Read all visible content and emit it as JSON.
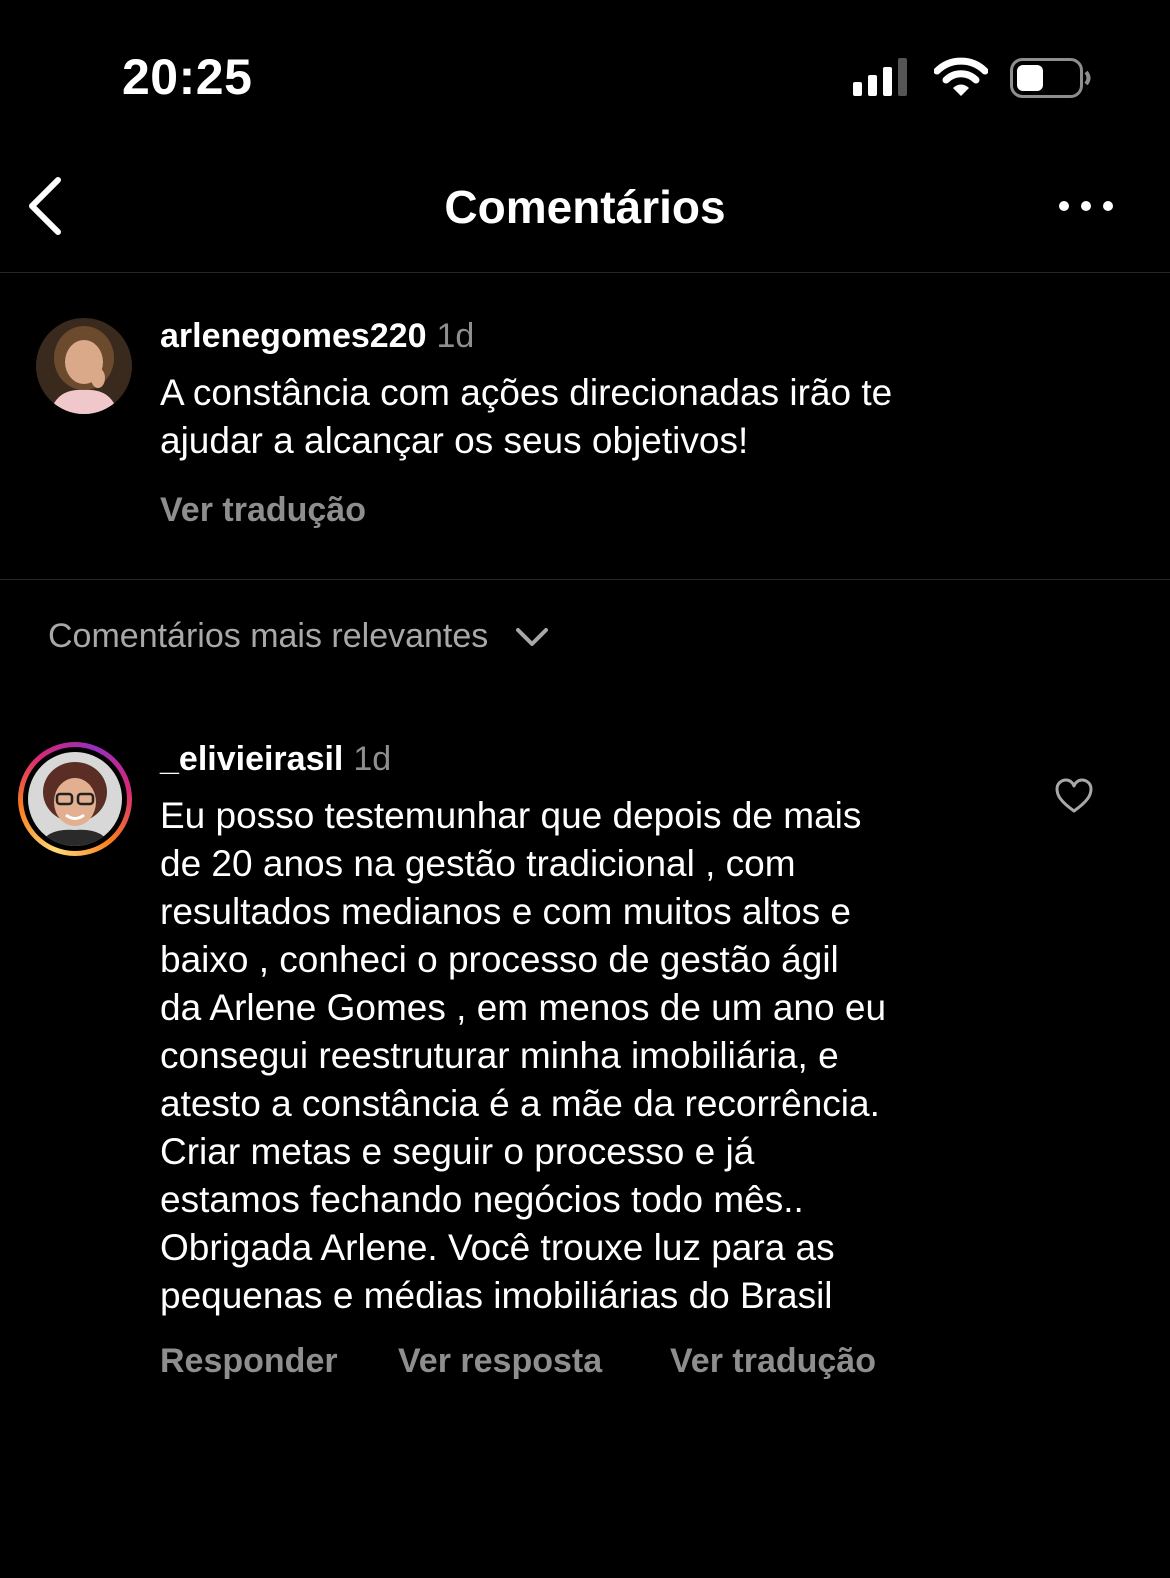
{
  "status_bar": {
    "time": "20:25",
    "icons": [
      "cellular-signal-icon",
      "wifi-icon",
      "battery-icon"
    ]
  },
  "header": {
    "title": "Comentários",
    "back_icon": "chevron-left-icon",
    "more_icon": "more-horizontal-icon"
  },
  "caption": {
    "username": "arlenegomes220",
    "time": "1d",
    "text_lines": [
      "A constância com ações direcionadas irão te",
      "ajudar a alcançar os seus objetivos!"
    ],
    "translate_label": "Ver tradução"
  },
  "sort": {
    "label": "Comentários mais relevantes",
    "icon": "chevron-down-icon"
  },
  "comments": [
    {
      "username": "_elivieirasil",
      "time": "1d",
      "has_story_ring": true,
      "text_lines": [
        "Eu posso testemunhar que depois de mais",
        "de 20 anos na gestão tradicional , com",
        "resultados medianos e com muitos altos e",
        "baixo , conheci o processo de gestão ágil",
        "da Arlene Gomes , em menos de um ano eu",
        "consegui reestruturar minha imobiliária, e",
        "atesto a constância é a mãe da recorrência.",
        "Criar metas e seguir o processo e já",
        "estamos fechando negócios todo mês..",
        "Obrigada Arlene. Você trouxe luz para as",
        "pequenas e médias imobiliárias do Brasil"
      ],
      "reply_label": "Responder",
      "view_reply_label": "Ver resposta",
      "translate_label": "Ver tradução",
      "like_icon": "heart-outline-icon"
    }
  ]
}
